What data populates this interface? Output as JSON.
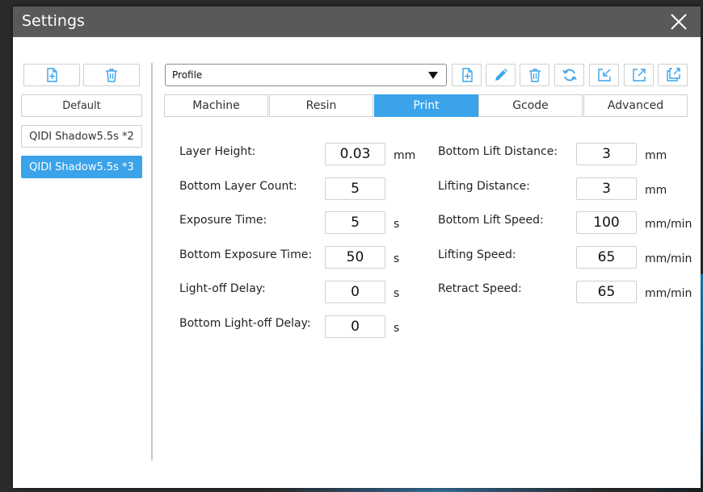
{
  "window": {
    "title": "Settings"
  },
  "sidebar": {
    "items": [
      {
        "label": "Default",
        "selected": false
      },
      {
        "label": "QIDI Shadow5.5s *2",
        "selected": false
      },
      {
        "label": "QIDI Shadow5.5s *3",
        "selected": true
      }
    ],
    "actions": [
      "add-file-icon",
      "trash-icon"
    ]
  },
  "profile": {
    "selected": "Profile",
    "toolbar_icons": [
      "add-file-icon",
      "pencil-icon",
      "trash-icon",
      "refresh-icon",
      "import-icon",
      "export-icon",
      "export-all-icon"
    ]
  },
  "tabs": [
    {
      "label": "Machine",
      "active": false
    },
    {
      "label": "Resin",
      "active": false
    },
    {
      "label": "Print",
      "active": true
    },
    {
      "label": "Gcode",
      "active": false
    },
    {
      "label": "Advanced",
      "active": false
    }
  ],
  "left_fields": [
    {
      "label": "Layer Height:",
      "value": "0.03",
      "unit": "mm"
    },
    {
      "label": "Bottom Layer Count:",
      "value": "5",
      "unit": ""
    },
    {
      "label": "Exposure Time:",
      "value": "5",
      "unit": "s"
    },
    {
      "label": "Bottom Exposure Time:",
      "value": "50",
      "unit": "s"
    },
    {
      "label": "Light-off Delay:",
      "value": "0",
      "unit": "s"
    },
    {
      "label": "Bottom Light-off Delay:",
      "value": "0",
      "unit": "s"
    }
  ],
  "right_fields": [
    {
      "label": "Bottom Lift Distance:",
      "value": "3",
      "unit": "mm"
    },
    {
      "label": "Lifting Distance:",
      "value": "3",
      "unit": "mm"
    },
    {
      "label": "Bottom Lift Speed:",
      "value": "100",
      "unit": "mm/min"
    },
    {
      "label": "Lifting Speed:",
      "value": "65",
      "unit": "mm/min"
    },
    {
      "label": "Retract Speed:",
      "value": "65",
      "unit": "mm/min"
    }
  ],
  "colors": {
    "accent": "#3aa3ea",
    "titlebar": "#595959"
  }
}
